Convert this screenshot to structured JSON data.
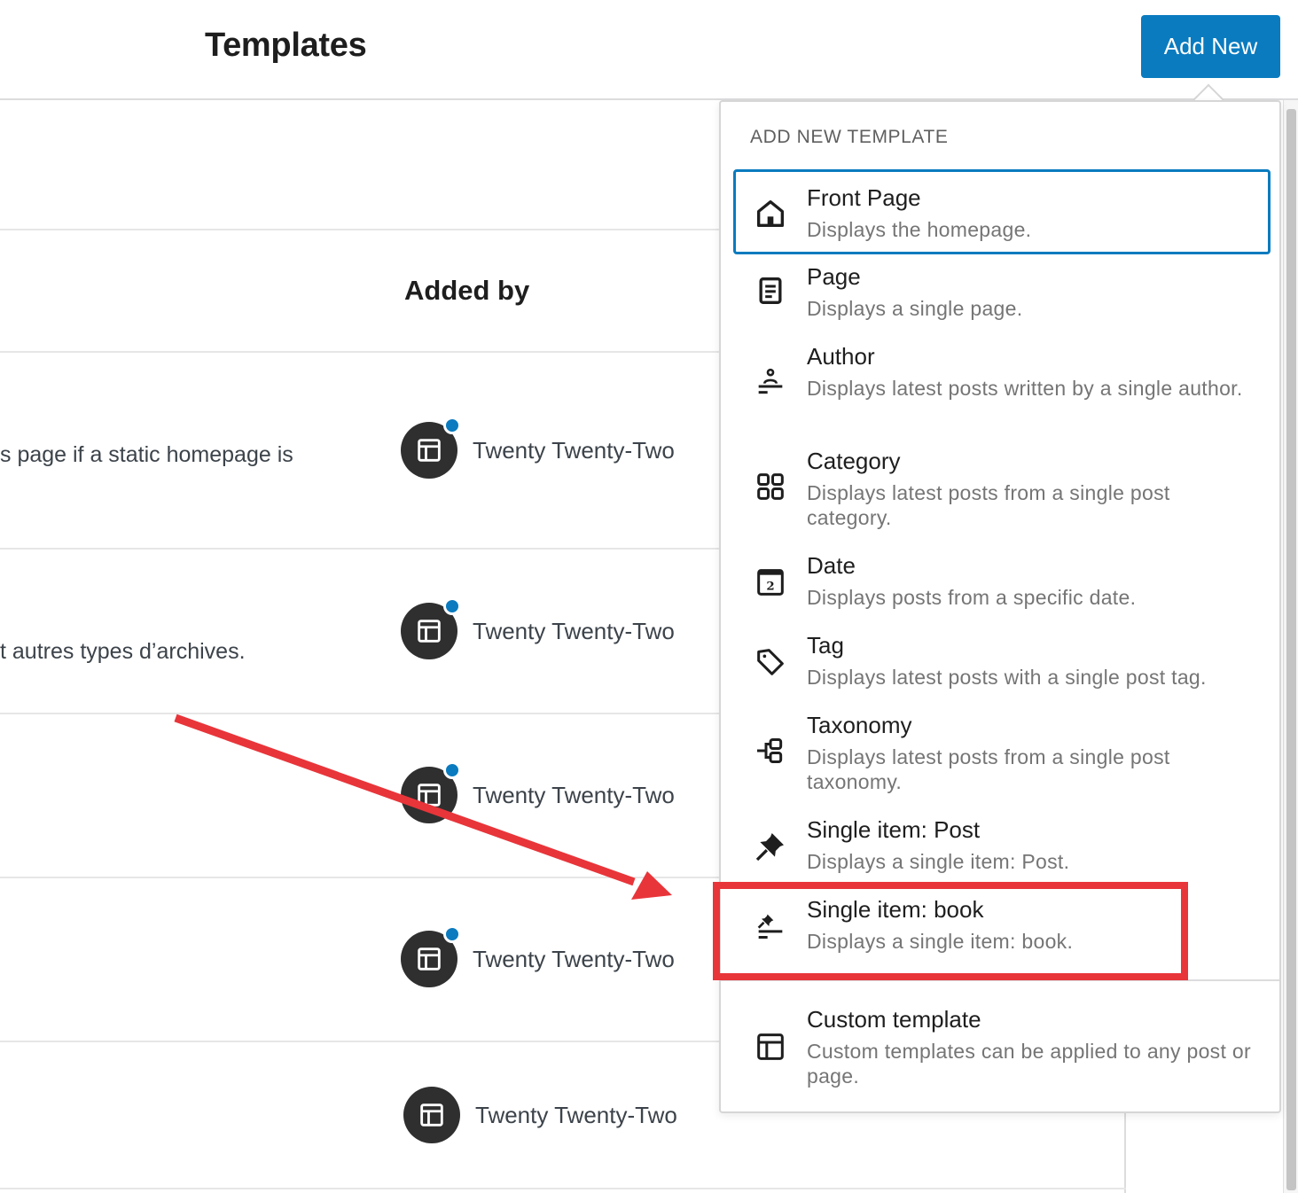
{
  "header": {
    "title": "Templates",
    "add_new_label": "Add New"
  },
  "table": {
    "column_added_by": "Added by",
    "rows": [
      {
        "description_fragment": "s page if a static homepage is",
        "added_by": "Twenty Twenty-Two",
        "has_badge": true
      },
      {
        "description_fragment": "t autres types d’archives.",
        "added_by": "Twenty Twenty-Two",
        "has_badge": true
      },
      {
        "description_fragment": "",
        "added_by": "Twenty Twenty-Two",
        "has_badge": true
      },
      {
        "description_fragment": "",
        "added_by": "Twenty Twenty-Two",
        "has_badge": true
      },
      {
        "description_fragment": "",
        "added_by": "Twenty Twenty-Two",
        "has_badge": false
      }
    ]
  },
  "popover": {
    "title": "ADD NEW TEMPLATE",
    "items": [
      {
        "label": "Front Page",
        "description": "Displays the homepage.",
        "icon": "home-icon",
        "focused": true
      },
      {
        "label": "Page",
        "description": "Displays a single page.",
        "icon": "page-icon"
      },
      {
        "label": "Author",
        "description": "Displays latest posts written by a single author.",
        "icon": "author-icon"
      },
      {
        "label": "Category",
        "description": "Displays latest posts from a single post category.",
        "icon": "category-icon"
      },
      {
        "label": "Date",
        "description": "Displays posts from a specific date.",
        "icon": "calendar-icon",
        "icon_text": "2"
      },
      {
        "label": "Tag",
        "description": "Displays latest posts with a single post tag.",
        "icon": "tag-icon"
      },
      {
        "label": "Taxonomy",
        "description": "Displays latest posts from a single post taxonomy.",
        "icon": "taxonomy-icon"
      },
      {
        "label": "Single item: Post",
        "description": "Displays a single item: Post.",
        "icon": "pin-icon"
      },
      {
        "label": "Single item: book",
        "description": "Displays a single item: book.",
        "icon": "post-list-icon",
        "highlighted": true
      }
    ],
    "custom": {
      "label": "Custom template",
      "description": "Custom templates can be applied to any post or page.",
      "icon": "layout-icon"
    }
  },
  "colors": {
    "accent": "#0a7bbf",
    "annotation": "#e8353a",
    "avatar_bg": "#2f2f2f"
  }
}
